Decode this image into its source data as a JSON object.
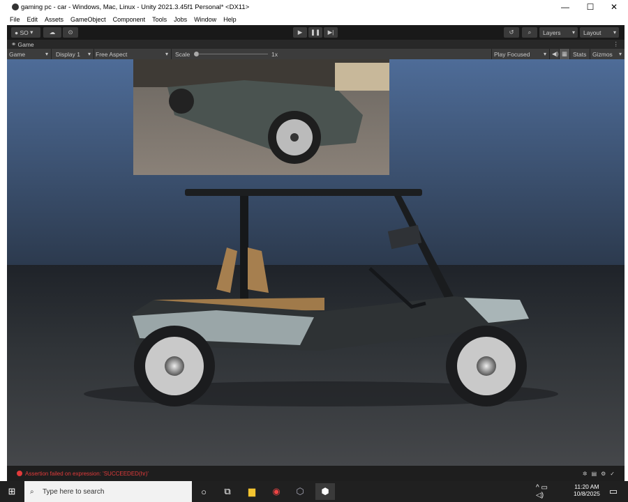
{
  "window": {
    "title": "gaming pc - car - Windows, Mac, Linux - Unity 2021.3.45f1 Personal* <DX11>",
    "minimize": "—",
    "maximize": "☐",
    "close": "✕"
  },
  "menu": [
    "File",
    "Edit",
    "Assets",
    "GameObject",
    "Component",
    "Tools",
    "Jobs",
    "Window",
    "Help"
  ],
  "toolbar": {
    "account": "SO",
    "layers": "Layers",
    "layout": "Layout",
    "icons": [
      "account-icon",
      "cloud-icon",
      "collab-icon",
      "play-icon",
      "pause-icon",
      "step-icon",
      "history-icon",
      "search-icon"
    ]
  },
  "game_tab": {
    "label": "Game"
  },
  "game_bar": {
    "mode": "Game",
    "display": "Display 1",
    "aspect": "Free Aspect",
    "scale_label": "Scale",
    "scale_value": "1x",
    "play_focused": "Play Focused",
    "stats": "Stats",
    "gizmos": "Gizmos"
  },
  "status": {
    "message": "Assertion failed on expression: 'SUCCEEDED(hr)'",
    "color": "#e23b3b"
  },
  "taskbar": {
    "search_placeholder": "Type here to search",
    "time": "11:20 AM",
    "date": "10/8/2025"
  }
}
